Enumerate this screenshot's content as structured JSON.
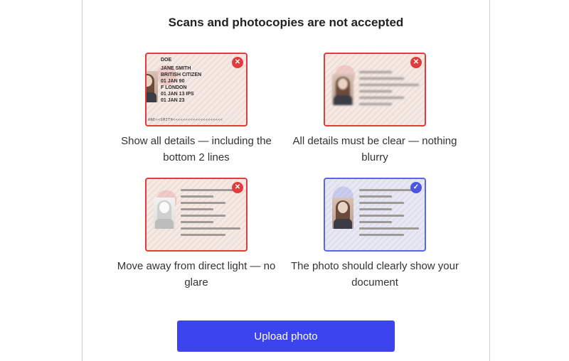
{
  "page": {
    "title": "Scans and photocopies are not accepted"
  },
  "examples": [
    {
      "caption": "Show all details — including the bottom 2 lines",
      "status": "rejected",
      "status_icon": "x-icon",
      "card_text": [
        "DOE",
        "JANE SMITH",
        "BRITISH CITIZEN",
        "01 JAN 90",
        "F    LONDON",
        "01 JAN 13   IPS",
        "01 JAN 23"
      ],
      "mrz": "ANE<<SMITH<<<<<<<<<<<<<<<<<<<<"
    },
    {
      "caption": "All details must be clear — nothing blurry",
      "status": "rejected",
      "status_icon": "x-icon"
    },
    {
      "caption": "Move away from direct light — no glare",
      "status": "rejected",
      "status_icon": "x-icon"
    },
    {
      "caption": "The photo should clearly show your document",
      "status": "accepted",
      "status_icon": "check-icon"
    }
  ],
  "upload_button": {
    "label": "Upload photo"
  },
  "colors": {
    "rejected": "#e23b3b",
    "accepted": "#4a55e0",
    "button": "#3c44f0"
  }
}
